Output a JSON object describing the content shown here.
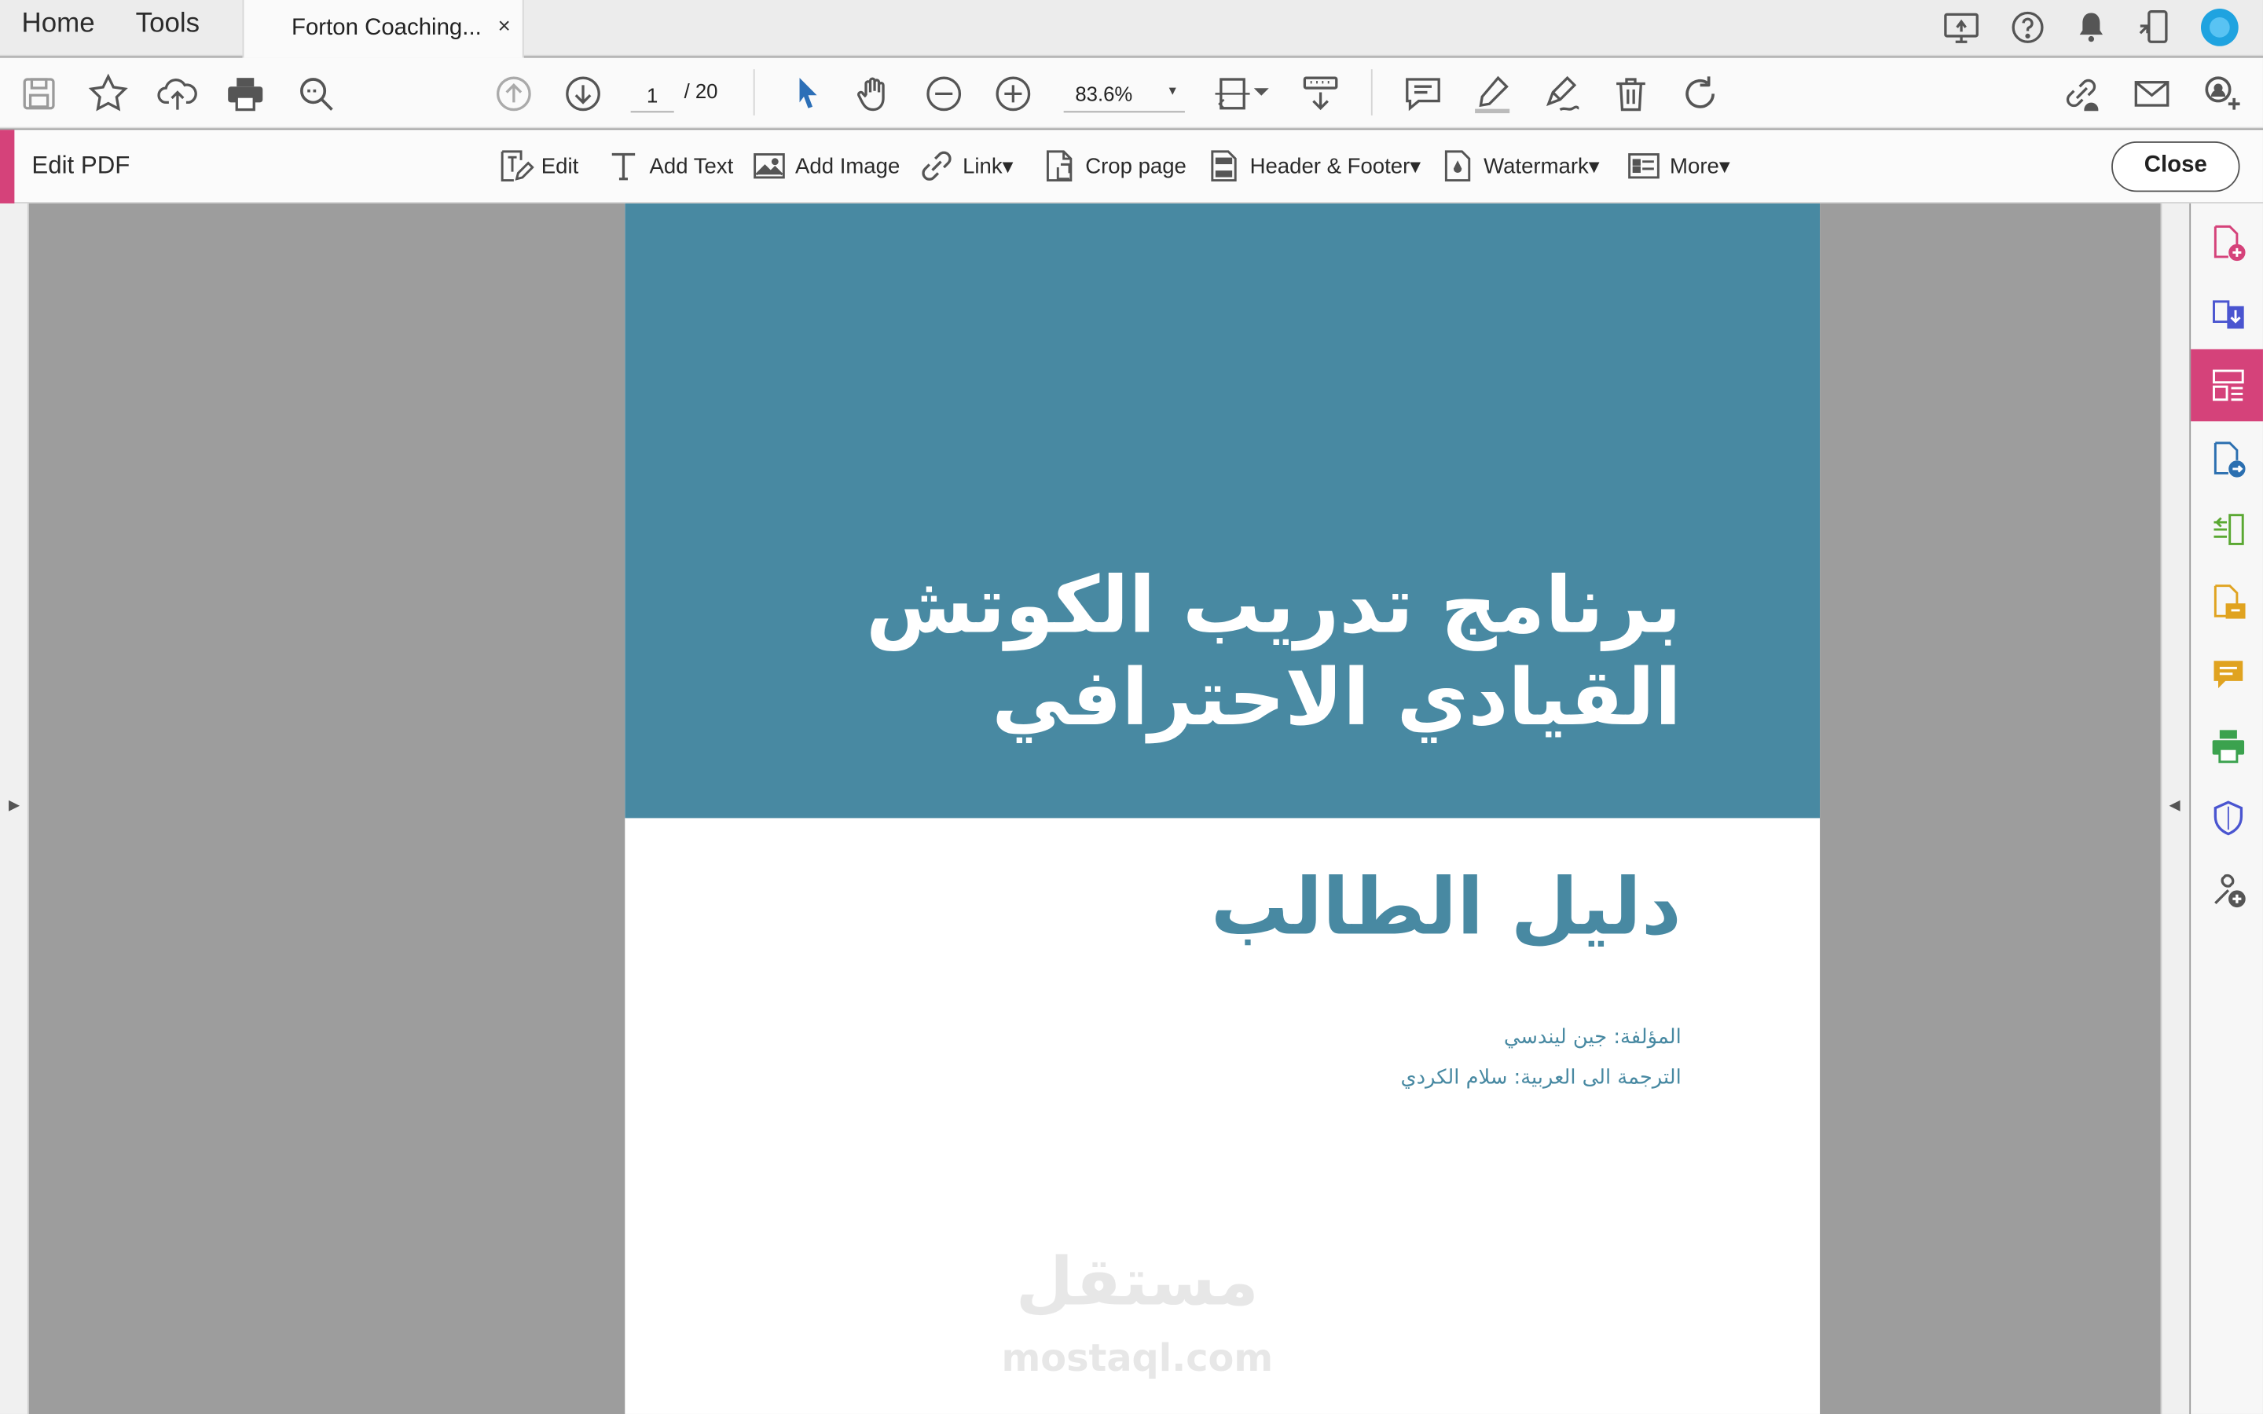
{
  "tabs": {
    "home": "Home",
    "tools": "Tools",
    "document": "Forton Coaching...",
    "close_glyph": "×"
  },
  "top_icons": [
    "share-screen-icon",
    "help-icon",
    "bell-icon",
    "mobile-link-icon",
    "user-avatar-icon"
  ],
  "toolbar": {
    "current_page": "1",
    "total_pages": "/  20",
    "zoom": "83.6%",
    "zoom_caret": "▾",
    "icons": [
      "save-icon",
      "bookmark-star-icon",
      "cloud-upload-icon",
      "print-icon",
      "zoom-search-icon",
      "page-up-icon",
      "page-down-icon",
      "select-arrow-icon",
      "hand-icon",
      "zoom-out-icon",
      "zoom-in-icon",
      "fit-page-icon",
      "scroll-mode-icon",
      "comment-icon",
      "highlight-icon",
      "sign-icon",
      "delete-icon",
      "rotate-icon",
      "link-share-icon",
      "email-icon",
      "add-user-icon"
    ]
  },
  "editbar": {
    "label": "Edit PDF",
    "tools": {
      "edit": "Edit",
      "add_text": "Add Text",
      "add_image": "Add Image",
      "link": "Link▾",
      "crop": "Crop page",
      "header_footer": "Header & Footer▾",
      "watermark": "Watermark▾",
      "more": "More▾"
    },
    "close": "Close"
  },
  "document": {
    "title_line1": "برنامج تدريب الكوتش",
    "title_line2": "القيادي الاحترافي",
    "subtitle": "دليل الطالب",
    "author": "المؤلفة: جين ليندسي",
    "translator": "الترجمة الى العربية: سلام الكردي",
    "watermark_ar": "مستقل",
    "watermark_en": "mostaql.com",
    "banner_color": "#4889a2"
  },
  "gutters": {
    "left_arrow": "▶",
    "right_arrow": "◀"
  },
  "tool_panel": {
    "accent_color": "#d5427a",
    "items": [
      "create-pdf-icon",
      "export-pdf-icon",
      "edit-pdf-icon",
      "combine-files-icon",
      "organize-pages-icon",
      "fill-sign-icon",
      "comment-tool-icon",
      "print-production-icon",
      "protect-icon",
      "more-tools-icon"
    ],
    "active": "edit-pdf-icon"
  }
}
